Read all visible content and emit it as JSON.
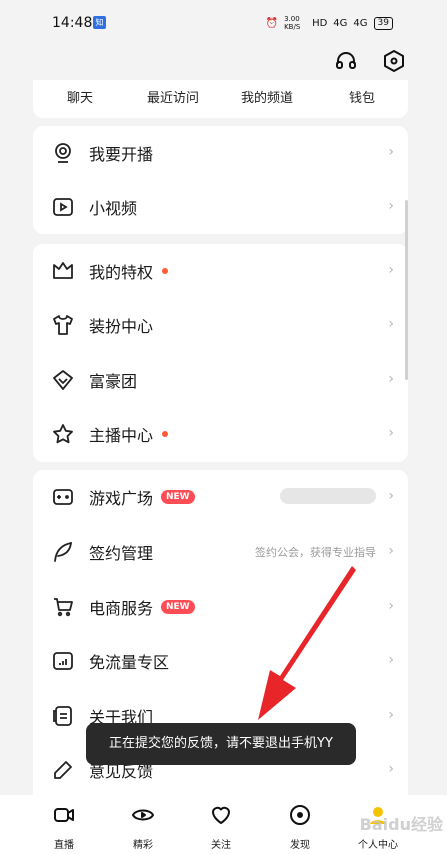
{
  "status_bar": {
    "time": "14:48",
    "app_badge": "知",
    "speed": "3.00 KB/S",
    "network": "HD",
    "signal_1": "4G",
    "signal_2": "4G",
    "battery": "39"
  },
  "quick_links": [
    "聊天",
    "最近访问",
    "我的频道",
    "钱包"
  ],
  "sections": [
    {
      "rows": [
        {
          "label": "我要开播",
          "icon": "live-camera-icon"
        },
        {
          "label": "小视频",
          "icon": "video-play-icon"
        }
      ]
    },
    {
      "rows": [
        {
          "label": "我的特权",
          "icon": "crown-icon",
          "dot": true
        },
        {
          "label": "装扮中心",
          "icon": "tshirt-icon"
        },
        {
          "label": "富豪团",
          "icon": "diamond-icon"
        },
        {
          "label": "主播中心",
          "icon": "star-icon",
          "dot": true
        }
      ]
    },
    {
      "rows": [
        {
          "label": "游戏广场",
          "icon": "gamepad-icon",
          "badge": "NEW"
        },
        {
          "label": "签约管理",
          "icon": "quill-icon",
          "subtitle": "签约公会，获得专业指导"
        },
        {
          "label": "电商服务",
          "icon": "cart-icon",
          "badge": "NEW"
        },
        {
          "label": "免流量专区",
          "icon": "data-chart-icon"
        },
        {
          "label": "关于我们",
          "icon": "info-card-icon"
        },
        {
          "label": "意见反馈",
          "icon": "pen-icon"
        }
      ]
    }
  ],
  "toast": "正在提交您的反馈，请不要退出手机YY",
  "tabs": [
    {
      "label": "直播",
      "icon": "live-tab-icon"
    },
    {
      "label": "精彩",
      "icon": "eye-tab-icon"
    },
    {
      "label": "关注",
      "icon": "heart-tab-icon"
    },
    {
      "label": "发现",
      "icon": "compass-tab-icon"
    },
    {
      "label": "个人中心",
      "icon": "profile-tab-icon"
    }
  ],
  "watermark": "Baidu经验",
  "colors": {
    "accent": "#ff4d55",
    "dot": "#ff5a36",
    "background": "#f3f3f4",
    "arrow": "#e8262a",
    "toast_bg": "#2a2a2a"
  }
}
